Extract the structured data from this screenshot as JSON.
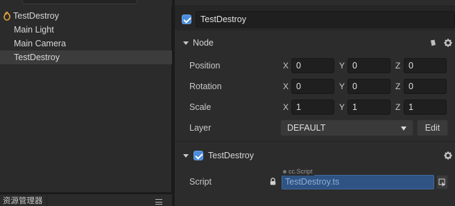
{
  "hierarchy": {
    "root_label": "TestDestroy",
    "items": [
      {
        "label": "Main Light",
        "selected": false
      },
      {
        "label": "Main Camera",
        "selected": false
      },
      {
        "label": "TestDestroy",
        "selected": true
      }
    ]
  },
  "assets_panel": {
    "tab_label": "资源管理器",
    "menu_icon": "hamburger-menu-icon"
  },
  "inspector": {
    "node_name": "TestDestroy",
    "node_active": true,
    "node_section": {
      "title": "Node",
      "position": {
        "label": "Position",
        "x": "0",
        "y": "0",
        "z": "0"
      },
      "rotation": {
        "label": "Rotation",
        "x": "0",
        "y": "0",
        "z": "0"
      },
      "scale": {
        "label": "Scale",
        "x": "1",
        "y": "1",
        "z": "1"
      },
      "layer": {
        "label": "Layer",
        "value": "DEFAULT",
        "edit_label": "Edit"
      },
      "axis_labels": {
        "x": "X",
        "y": "Y",
        "z": "Z"
      }
    },
    "component": {
      "title": "TestDestroy",
      "enabled": true,
      "script_label": "Script",
      "script_type_tag": "cc.Script",
      "script_value": "TestDestroy.ts"
    }
  },
  "colors": {
    "accent": "#4b8cdb",
    "panel_bg": "#2c2c2c",
    "selected_row": "#3c3c3c",
    "script_field": "#2f5382"
  }
}
